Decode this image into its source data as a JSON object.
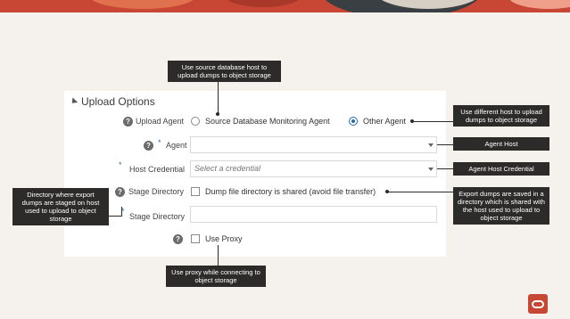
{
  "section": {
    "title": "Upload Options"
  },
  "form": {
    "upload_agent": {
      "label": "Upload Agent",
      "options": [
        "Source Database Monitoring Agent",
        "Other Agent"
      ],
      "selected": "Other Agent"
    },
    "agent": {
      "label": "Agent",
      "required": "*",
      "value": ""
    },
    "host_credential": {
      "label": "Host Credential",
      "required": "*",
      "placeholder": "Select a credential"
    },
    "stage_directory": {
      "label": "Stage Directory",
      "checkbox_label": "Dump file directory is shared (avoid file transfer)",
      "checked": false
    },
    "stage_directory_field": {
      "label": "Stage Directory",
      "required": "*",
      "value": ""
    },
    "use_proxy": {
      "label": "Use Proxy",
      "checked": false
    }
  },
  "callouts": {
    "top": "Use source database host to upload dumps to object storage",
    "other_agent": "Use different host to upload dumps to object storage",
    "agent_host": "Agent Host",
    "agent_host_credential": "Agent Host Credential",
    "export_dumps": "Export dumps are saved in a directory which is shared with the host used to upload to object storage",
    "stage_dir": "Directory where export dumps are staged on host used to upload to object storage",
    "proxy": "Use proxy while connecting to object storage"
  },
  "icons": [
    "help-icon",
    "chevron-down-icon",
    "oracle-logo"
  ],
  "colors": {
    "accent": "#1f6bb5",
    "callout_bg": "#2d2b29",
    "brand": "#c74634"
  }
}
